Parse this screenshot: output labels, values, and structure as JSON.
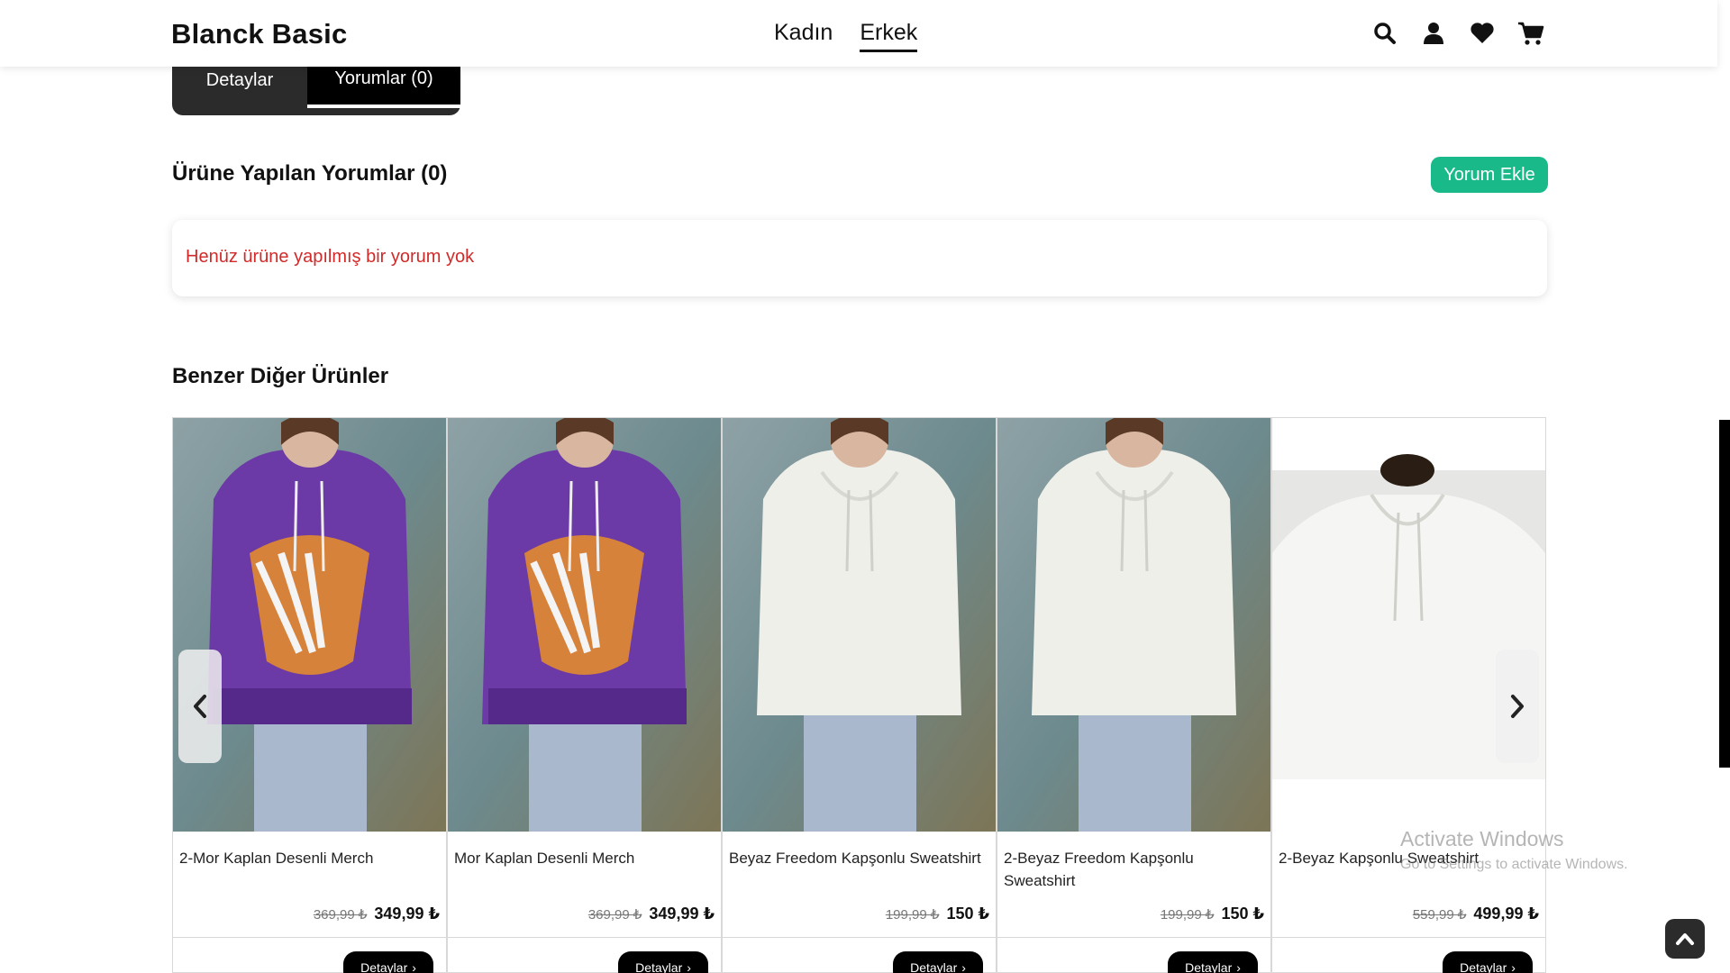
{
  "header": {
    "brand": "Blanck Basic",
    "nav": [
      {
        "label": "Kadın",
        "active": false
      },
      {
        "label": "Erkek",
        "active": true
      }
    ],
    "icons": [
      "search-icon",
      "user-icon",
      "heart-icon",
      "cart-icon"
    ]
  },
  "tabs": {
    "details": "Detaylar",
    "reviews": "Yorumlar (0)"
  },
  "reviews": {
    "title": "Ürüne Yapılan Yorumlar (0)",
    "add_button": "Yorum Ekle",
    "empty_message": "Henüz ürüne yapılmış bir yorum yok"
  },
  "similar": {
    "title": "Benzer Diğer Ürünler",
    "products": [
      {
        "name": "2-Mor Kaplan Desenli Merch",
        "old_price": "369,99 ₺",
        "price": "349,99 ₺",
        "button": "Detaylar"
      },
      {
        "name": "Mor Kaplan Desenli Merch",
        "old_price": "369,99 ₺",
        "price": "349,99 ₺",
        "button": "Detaylar"
      },
      {
        "name": "Beyaz Freedom Kapşonlu Sweatshirt",
        "old_price": "199,99 ₺",
        "price": "150 ₺",
        "button": "Detaylar"
      },
      {
        "name": "2-Beyaz Freedom Kapşonlu Sweatshirt",
        "old_price": "199,99 ₺",
        "price": "150 ₺",
        "button": "Detaylar"
      },
      {
        "name": "2-Beyaz Kapşonlu Sweatshirt",
        "old_price": "559,99 ₺",
        "price": "499,99 ₺",
        "button": "Detaylar"
      }
    ]
  },
  "watermark": {
    "line1": "Activate Windows",
    "line2": "Go to Settings to activate Windows."
  },
  "colors": {
    "accent": "#19b98a",
    "error": "#d12a2a",
    "dark": "#2b2b2b"
  }
}
